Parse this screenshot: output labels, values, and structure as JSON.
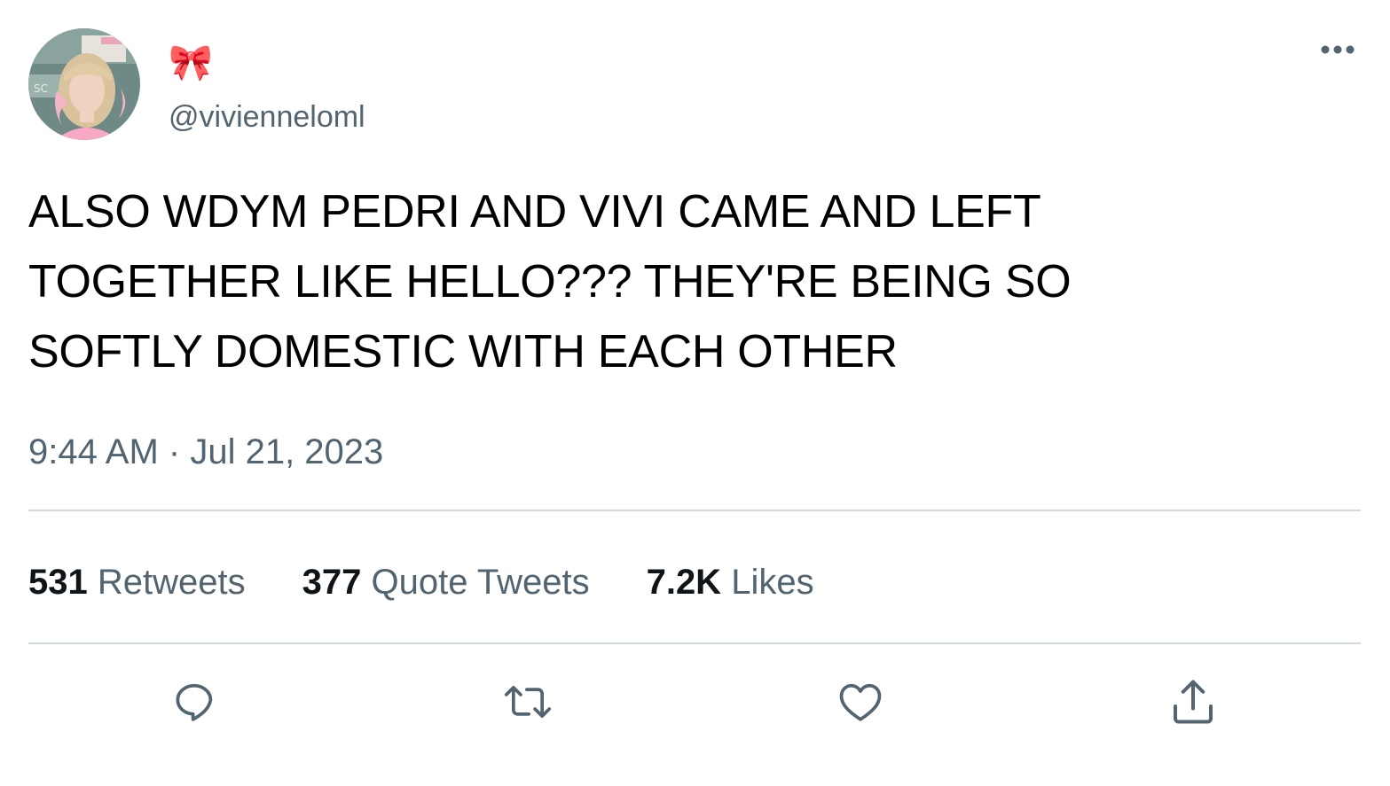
{
  "author": {
    "display_name": "🎀",
    "handle": "@vivienneloml",
    "avatar_icon": "profile-photo",
    "avatar_sign_text": "SC"
  },
  "menu": {
    "more_icon": "more-horizontal-icon"
  },
  "tweet": {
    "text": "ALSO WDYM PEDRI AND VIVI CAME AND LEFT\nTOGETHER LIKE HELLO??? THEY'RE BEING SO\nSOFTLY DOMESTIC WITH EACH OTHER",
    "time": "9:44 AM",
    "separator": "·",
    "date": "Jul 21, 2023"
  },
  "stats": {
    "retweets_count": "531",
    "retweets_label": "Retweets",
    "quotes_count": "377",
    "quotes_label": "Quote Tweets",
    "likes_count": "7.2K",
    "likes_label": "Likes"
  },
  "actions": [
    {
      "icon": "reply-icon"
    },
    {
      "icon": "retweet-icon"
    },
    {
      "icon": "like-heart-icon"
    },
    {
      "icon": "share-icon"
    }
  ],
  "colors": {
    "text_primary": "#0f1419",
    "text_secondary": "#536471",
    "divider": "#cfd9de",
    "bow_pink": "#ff4d94"
  }
}
